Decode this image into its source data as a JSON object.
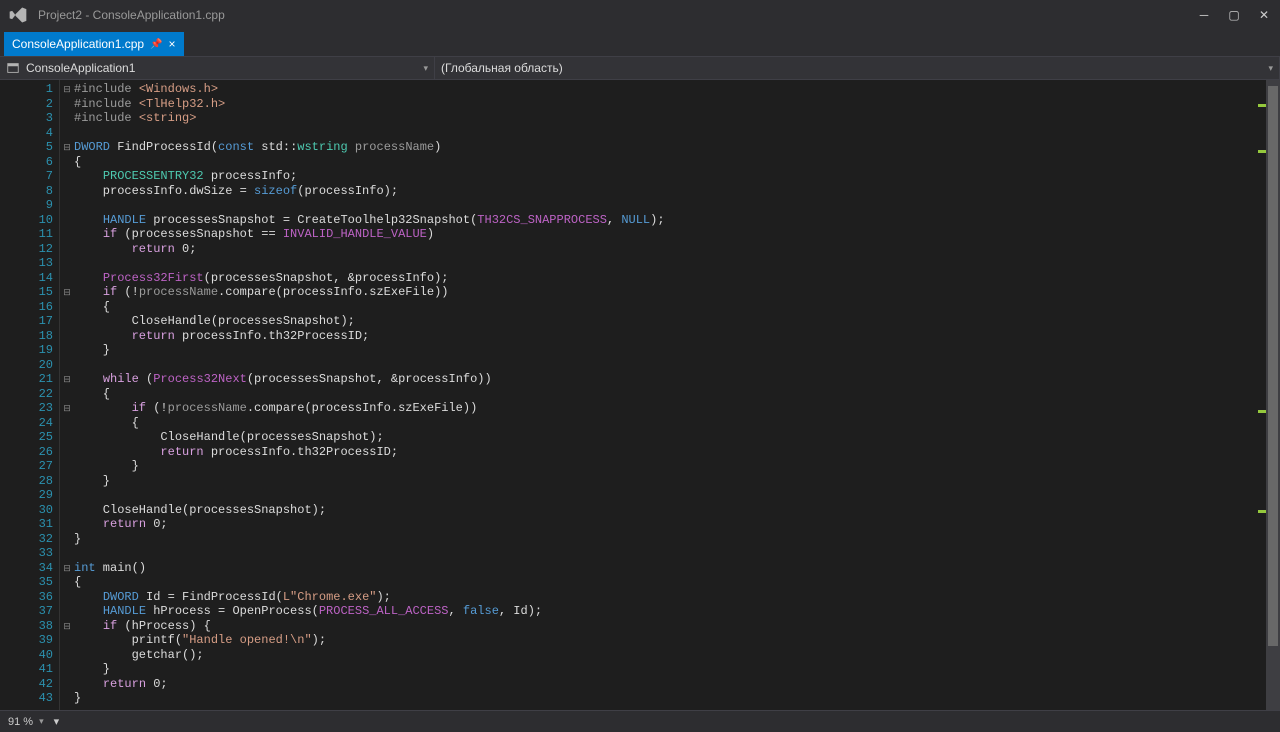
{
  "window": {
    "title": "Project2 - ConsoleApplication1.cpp"
  },
  "tab": {
    "label": "ConsoleApplication1.cpp"
  },
  "nav": {
    "left": "ConsoleApplication1",
    "right": "(Глобальная область)"
  },
  "footer": {
    "zoom": "91 %"
  },
  "code": {
    "lines": [
      {
        "n": 1,
        "fold": "⊟",
        "html": "<span class='k-gray'>#include</span> <span class='k-str'>&lt;Windows.h&gt;</span>"
      },
      {
        "n": 2,
        "fold": "",
        "html": "<span class='k-gray'>#include</span> <span class='k-str'>&lt;TlHelp32.h&gt;</span>"
      },
      {
        "n": 3,
        "fold": "",
        "html": "<span class='k-gray'>#include</span> <span class='k-str'>&lt;string&gt;</span>"
      },
      {
        "n": 4,
        "fold": "",
        "html": ""
      },
      {
        "n": 5,
        "fold": "⊟",
        "html": "<span class='k-blue'>DWORD</span> FindProcessId(<span class='k-blue'>const</span> std::<span class='k-teal'>wstring</span> <span class='k-gray'>processName</span>)"
      },
      {
        "n": 6,
        "fold": "",
        "html": "{"
      },
      {
        "n": 7,
        "fold": "",
        "html": "    <span class='k-teal'>PROCESSENTRY32</span> processInfo;"
      },
      {
        "n": 8,
        "fold": "",
        "html": "    processInfo.dwSize = <span class='k-blue'>sizeof</span>(processInfo);"
      },
      {
        "n": 9,
        "fold": "",
        "html": ""
      },
      {
        "n": 10,
        "fold": "",
        "html": "    <span class='k-blue'>HANDLE</span> processesSnapshot = CreateToolhelp32Snapshot(<span class='k-macro'>TH32CS_SNAPPROCESS</span>, <span class='k-blue'>NULL</span>);"
      },
      {
        "n": 11,
        "fold": "",
        "html": "    <span class='k-purple'>if</span> (processesSnapshot == <span class='k-macro'>INVALID_HANDLE_VALUE</span>)"
      },
      {
        "n": 12,
        "fold": "",
        "html": "        <span class='k-purple'>return</span> 0;"
      },
      {
        "n": 13,
        "fold": "",
        "html": ""
      },
      {
        "n": 14,
        "fold": "",
        "html": "    <span class='k-macro'>Process32First</span>(processesSnapshot, &amp;processInfo);"
      },
      {
        "n": 15,
        "fold": "⊟",
        "html": "    <span class='k-purple'>if</span> (!<span class='k-gray'>processName</span>.compare(processInfo.szExeFile))"
      },
      {
        "n": 16,
        "fold": "",
        "html": "    {"
      },
      {
        "n": 17,
        "fold": "",
        "html": "        CloseHandle(processesSnapshot);"
      },
      {
        "n": 18,
        "fold": "",
        "html": "        <span class='k-purple'>return</span> processInfo.th32ProcessID;"
      },
      {
        "n": 19,
        "fold": "",
        "html": "    }"
      },
      {
        "n": 20,
        "fold": "",
        "html": ""
      },
      {
        "n": 21,
        "fold": "⊟",
        "html": "    <span class='k-purple'>while</span> (<span class='k-macro'>Process32Next</span>(processesSnapshot, &amp;processInfo))"
      },
      {
        "n": 22,
        "fold": "",
        "html": "    {"
      },
      {
        "n": 23,
        "fold": "⊟",
        "html": "        <span class='k-purple'>if</span> (!<span class='k-gray'>processName</span>.compare(processInfo.szExeFile))"
      },
      {
        "n": 24,
        "fold": "",
        "html": "        {"
      },
      {
        "n": 25,
        "fold": "",
        "html": "            CloseHandle(processesSnapshot);"
      },
      {
        "n": 26,
        "fold": "",
        "html": "            <span class='k-purple'>return</span> processInfo.th32ProcessID;"
      },
      {
        "n": 27,
        "fold": "",
        "html": "        }"
      },
      {
        "n": 28,
        "fold": "",
        "html": "    }"
      },
      {
        "n": 29,
        "fold": "",
        "html": ""
      },
      {
        "n": 30,
        "fold": "",
        "html": "    CloseHandle(processesSnapshot);"
      },
      {
        "n": 31,
        "fold": "",
        "html": "    <span class='k-purple'>return</span> 0;"
      },
      {
        "n": 32,
        "fold": "",
        "html": "}"
      },
      {
        "n": 33,
        "fold": "",
        "html": ""
      },
      {
        "n": 34,
        "fold": "⊟",
        "html": "<span class='k-blue'>int</span> main()"
      },
      {
        "n": 35,
        "fold": "",
        "html": "{"
      },
      {
        "n": 36,
        "fold": "",
        "html": "    <span class='k-blue'>DWORD</span> Id = FindProcessId(<span class='k-str'>L\"Chrome.exe\"</span>);"
      },
      {
        "n": 37,
        "fold": "",
        "html": "    <span class='k-blue'>HANDLE</span> hProcess = OpenProcess(<span class='k-macro'>PROCESS_ALL_ACCESS</span>, <span class='k-blue'>false</span>, Id);"
      },
      {
        "n": 38,
        "fold": "⊟",
        "html": "    <span class='k-purple'>if</span> (hProcess) {"
      },
      {
        "n": 39,
        "fold": "",
        "html": "        printf(<span class='k-str'>\"Handle opened!\\n\"</span>);"
      },
      {
        "n": 40,
        "fold": "",
        "html": "        getchar();"
      },
      {
        "n": 41,
        "fold": "",
        "html": "    }"
      },
      {
        "n": 42,
        "fold": "",
        "html": "    <span class='k-purple'>return</span> 0;"
      },
      {
        "n": 43,
        "fold": "",
        "html": "}"
      }
    ]
  }
}
